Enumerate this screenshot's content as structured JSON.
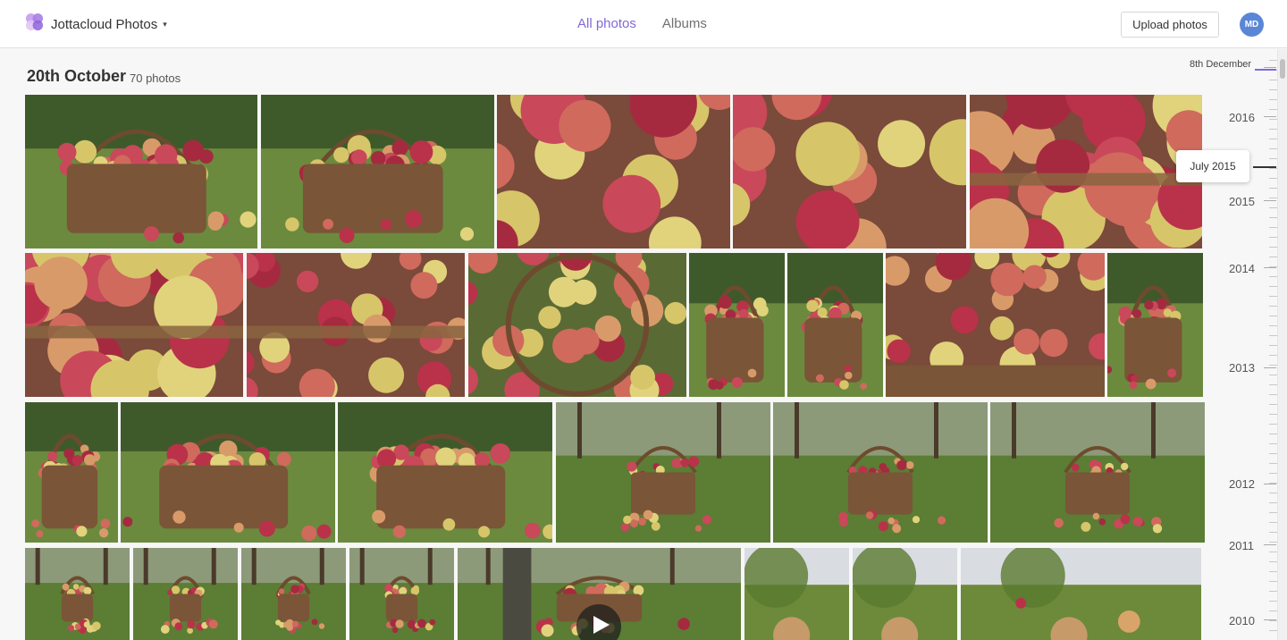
{
  "header": {
    "app_title": "Jottacloud Photos",
    "caret": "▾",
    "logo_icon": "jottacloud-logo-icon",
    "tabs": [
      {
        "label": "All photos",
        "active": true
      },
      {
        "label": "Albums",
        "active": false
      }
    ],
    "upload_label": "Upload photos",
    "avatar_initials": "MD"
  },
  "section": {
    "title": "20th October",
    "count": "70 photos"
  },
  "timeline": {
    "top_date": "8th December",
    "hover_tooltip": "July 2015",
    "years": [
      "2016",
      "2015",
      "2014",
      "2013",
      "2012",
      "2011",
      "2010"
    ]
  },
  "colors": {
    "accent": "#8368d8",
    "avatar": "#5a86d6"
  }
}
